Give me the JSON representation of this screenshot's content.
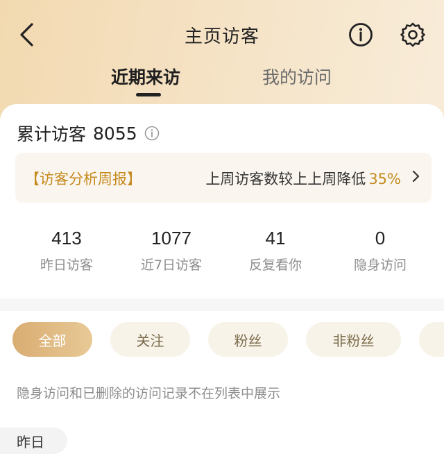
{
  "header": {
    "title": "主页访客",
    "tabs": [
      {
        "label": "近期来访",
        "active": true
      },
      {
        "label": "我的访问",
        "active": false
      }
    ]
  },
  "summary": {
    "total_label": "累计访客",
    "total_value": "8055"
  },
  "report": {
    "tag": "【访客分析周报】",
    "desc": "上周访客数较上上周降低",
    "percent": "35%"
  },
  "stats": [
    {
      "value": "413",
      "label": "昨日访客"
    },
    {
      "value": "1077",
      "label": "近7日访客"
    },
    {
      "value": "41",
      "label": "反复看你"
    },
    {
      "value": "0",
      "label": "隐身访问"
    }
  ],
  "filters": [
    {
      "label": "全部",
      "active": true
    },
    {
      "label": "关注",
      "active": false
    },
    {
      "label": "粉丝",
      "active": false
    },
    {
      "label": "非粉丝",
      "active": false
    },
    {
      "label": "",
      "active": false
    }
  ],
  "note": "隐身访问和已删除的访问记录不在列表中展示",
  "section_date": "昨日",
  "colors": {
    "accent": "#c48a1e",
    "chip_active": "#d9ad72",
    "chip_bg": "#f8f3e8",
    "header_bg": "#f2d9b0"
  },
  "icons": {
    "back": "back-arrow-icon",
    "info": "info-icon",
    "settings": "gear-icon",
    "chevron": "chevron-right-icon"
  }
}
